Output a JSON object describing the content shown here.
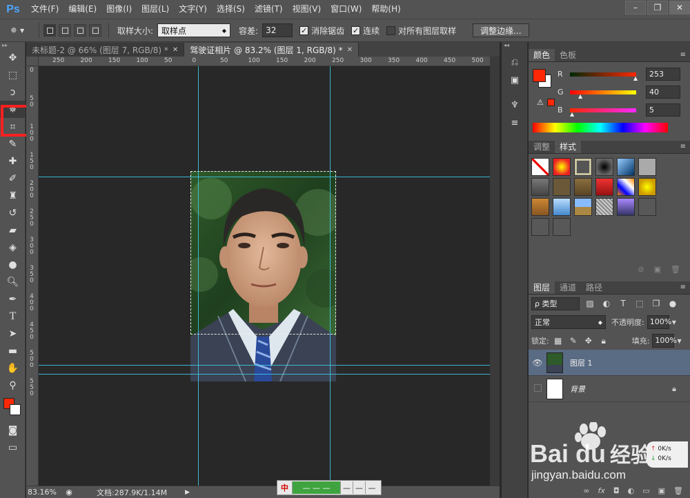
{
  "app": {
    "logo": "Ps",
    "menu": [
      "文件(F)",
      "编辑(E)",
      "图像(I)",
      "图层(L)",
      "文字(Y)",
      "选择(S)",
      "滤镜(T)",
      "视图(V)",
      "窗口(W)",
      "帮助(H)"
    ],
    "window_controls": [
      "–",
      "❐",
      "✕"
    ]
  },
  "options": {
    "sample_size_label": "取样大小:",
    "sample_size_value": "取样点",
    "tolerance_label": "容差:",
    "tolerance_value": "32",
    "anti_alias_label": "消除锯齿",
    "anti_alias_checked": true,
    "contiguous_label": "连续",
    "contiguous_checked": true,
    "sample_all_label": "对所有图层取样",
    "sample_all_checked": false,
    "refine_edge_label": "调整边缘..."
  },
  "tabs": [
    {
      "label": "未标题-2 @ 66% (图层 7, RGB/8) *",
      "active": false
    },
    {
      "label": "驾驶证相片 @ 83.2% (图层 1, RGB/8) *",
      "active": true
    }
  ],
  "ruler": {
    "h_ticks": [
      "250",
      "200",
      "150",
      "100",
      "50",
      "0",
      "50",
      "100",
      "150",
      "200",
      "250",
      "300",
      "350",
      "400",
      "450",
      "500"
    ],
    "v_ticks": [
      "0",
      "5\n0",
      "1\n0\n0",
      "1\n5\n0",
      "2\n0\n0",
      "2\n5\n0",
      "3\n0\n0",
      "3\n5\n0",
      "4\n0\n0",
      "4\n5\n0",
      "5\n0\n0",
      "5\n5\n0"
    ]
  },
  "status": {
    "zoom": "83.16%",
    "doc_size": "文档:287.9K/1.14M"
  },
  "color_panel": {
    "tabs": [
      "颜色",
      "色板"
    ],
    "r_label": "R",
    "r_value": "253",
    "g_label": "G",
    "g_value": "40",
    "b_label": "B",
    "b_value": "5",
    "fg_color": "#fd2805",
    "bg_color": "#ffffff"
  },
  "styles_panel": {
    "tabs": [
      "调整",
      "样式"
    ]
  },
  "layers_panel": {
    "tabs": [
      "图层",
      "通道",
      "路径"
    ],
    "kind_label": "ρ 类型",
    "blend_mode": "正常",
    "opacity_label": "不透明度:",
    "opacity_value": "100%",
    "lock_label": "锁定:",
    "fill_label": "填充:",
    "fill_value": "100%",
    "layers": [
      {
        "name": "图层 1",
        "selected": true,
        "visible": true
      },
      {
        "name": "背景",
        "selected": false,
        "visible": false,
        "locked": true
      }
    ]
  },
  "ime": {
    "logo": "中",
    "field": "—  —  —"
  },
  "network": {
    "up": "0K/s",
    "down": "0K/s"
  },
  "watermark": {
    "brand": "Bai",
    "brand2": "du",
    "jy": "经验",
    "url": "jingyan.baidu.com"
  }
}
